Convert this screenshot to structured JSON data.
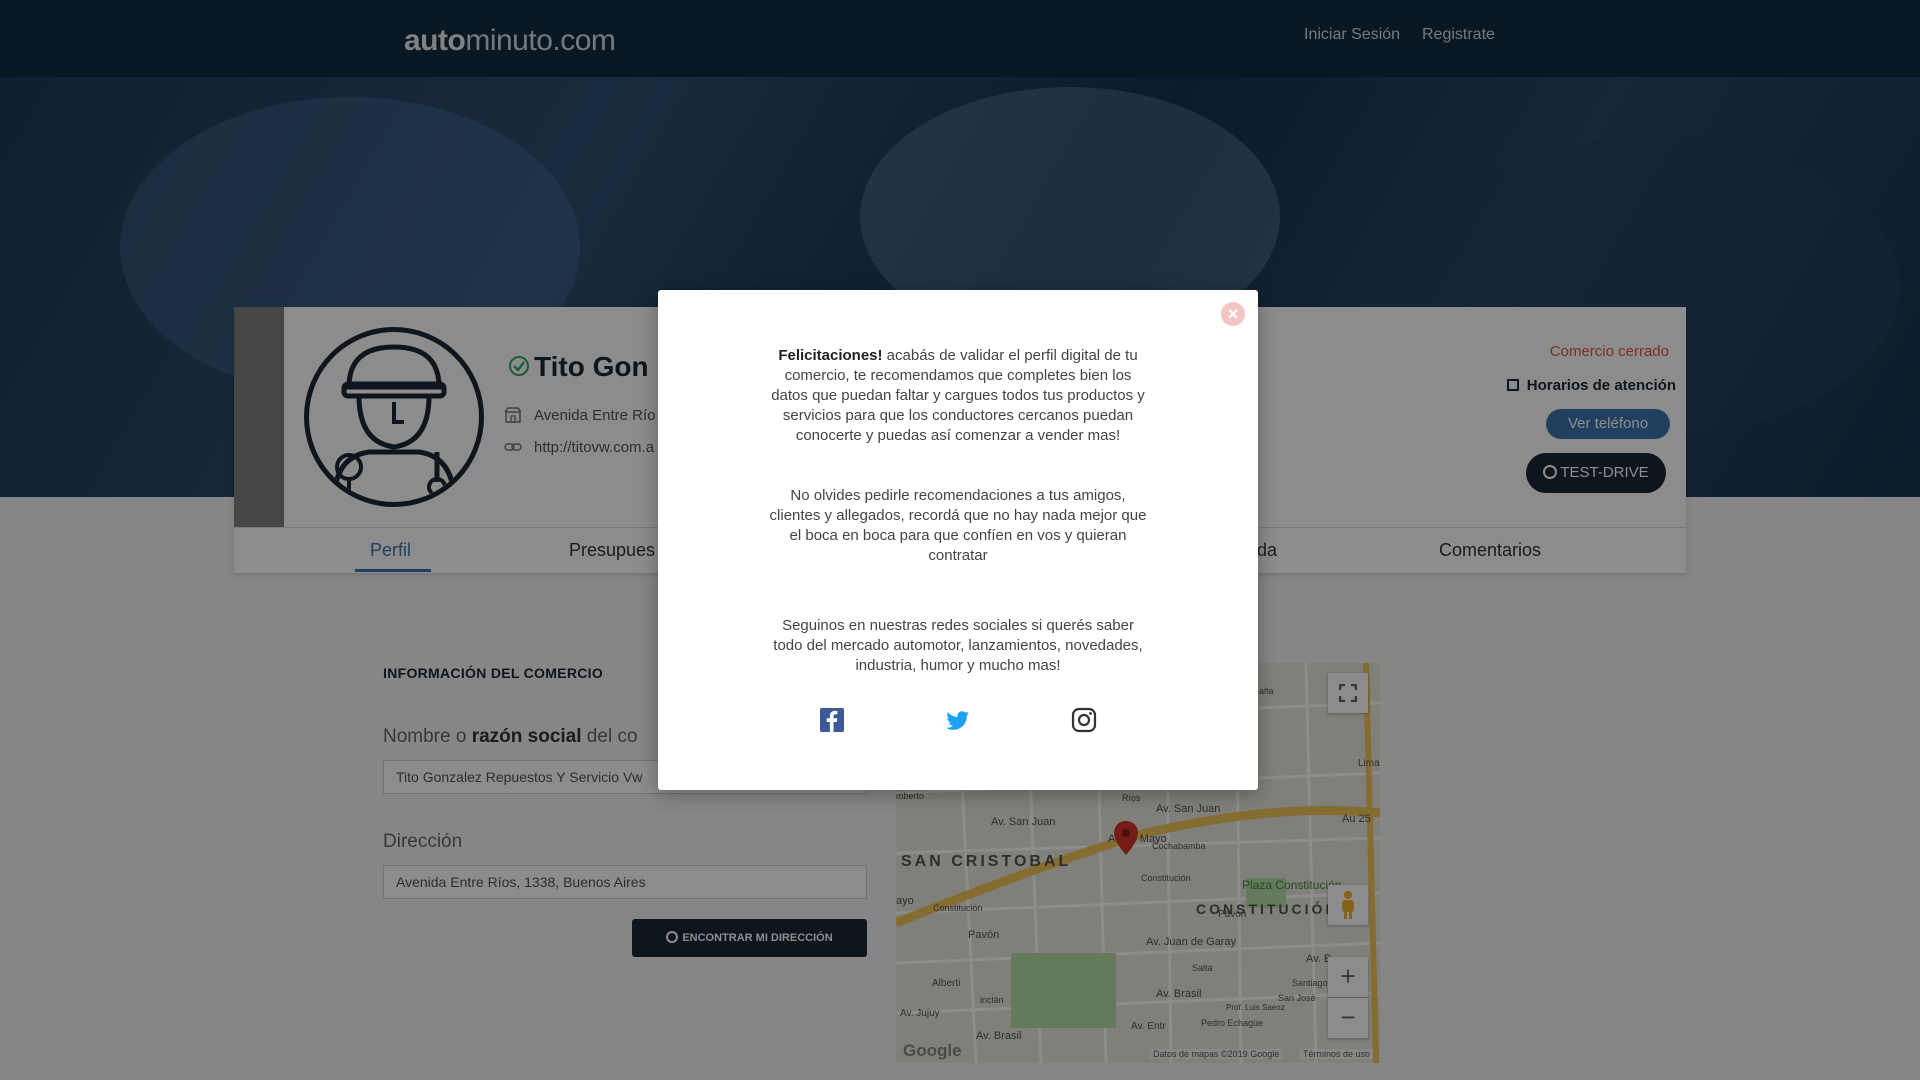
{
  "header": {
    "logo_bold": "auto",
    "logo_rest": "minuto.com",
    "login": "Iniciar Sesión",
    "register": "Registrate"
  },
  "profile": {
    "name": "Tito Gon",
    "address": "Avenida Entre Río",
    "website": "http://titovw.com.a",
    "status": "Comercio cerrado",
    "hours_label": "Horarios de atención",
    "phone_button": "Ver teléfono",
    "test_drive": "TEST-DRIVE"
  },
  "tabs": [
    {
      "label": "Perfil"
    },
    {
      "label": "Presupues"
    },
    {
      "label": "nda"
    },
    {
      "label": "Comentarios"
    }
  ],
  "form": {
    "section_title": "INFORMACIÓN DEL COMERCIO",
    "name_label_pre": "Nombre o ",
    "name_label_bold": "razón social",
    "name_label_post": " del co",
    "name_value": "Tito Gonzalez Repuestos Y Servicio Vw",
    "address_label": "Dirección",
    "address_value": "Avenida Entre Ríos, 1338, Buenos Aires",
    "find_button": "ENCONTRAR MI DIRECCIÓN"
  },
  "map": {
    "labels": {
      "san_cristobal": "SAN CRISTOBAL",
      "constitucion": "CONSTITUCIÓN",
      "plaza": "Plaza Constitución",
      "av_san_juan": "Av. San Juan",
      "av_san_juan2": "Av. San Juan",
      "au25": "Au 25",
      "mayo": "Au   de Mayo",
      "garay": "Av. Juan de Garay",
      "brasil": "Av. Brasil",
      "brasil2": "Av. Brasil",
      "pavon": "Pavón",
      "pavon2": "Pavón",
      "cochabamba": "Cochabamba",
      "constitucion_st": "Constitución",
      "constitucion_st2": "Constitución",
      "lima": "Lima",
      "alberti": "Alberti",
      "jujuy": "Av. Jujuy",
      "santiago": "Santiago del Es",
      "san_jose": "San José",
      "salta": "Salta",
      "pedro": "Pedro Echagüe",
      "humberto": "mberto",
      "ayo": "ayo",
      "avb": "Av. B",
      "rios": "Ríos",
      "sarte": "Salta",
      "luis_saenz": "Prof. Luis Saenz",
      "entre_rios": "Av. Entr",
      "incl": "inclán"
    },
    "google": "Google",
    "attribution": "Datos de mapas ©2019 Google",
    "terms": "Términos de uso"
  },
  "modal": {
    "p1_bold": "Felicitaciones!",
    "p1": " acabás de validar el perfil digital de tu comercio, te recomendamos que completes bien los datos que puedan faltar y cargues todos tus productos y servicios para que los conductores cercanos puedan conocerte y puedas así comenzar a vender mas!",
    "p2": "No olvides pedirle recomendaciones a tus amigos, clientes y allegados, recordá que no hay nada mejor que el boca en boca para que confíen en vos y quieran contratar",
    "p3": "Seguinos en nuestras redes sociales si querés saber todo del mercado automotor, lanzamientos, novedades, industria, humor y mucho mas!",
    "close": "×"
  },
  "colors": {
    "header_bg": "#0f2a3d",
    "accent_blue": "#3d74ad",
    "dark": "#1c2733",
    "closed_red": "#e5534b",
    "facebook": "#3b5998",
    "twitter": "#1da1f2"
  }
}
